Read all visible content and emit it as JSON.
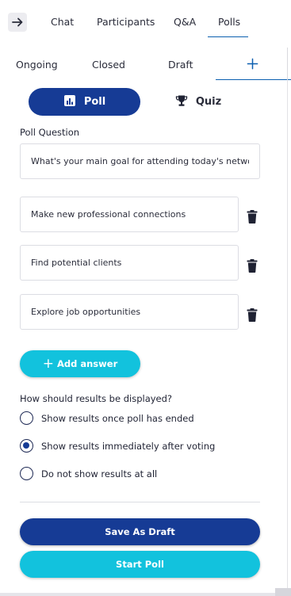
{
  "header": {
    "tabs": [
      "Chat",
      "Participants",
      "Q&A",
      "Polls"
    ],
    "active_tab": "Polls",
    "back_icon": "arrow-right-icon"
  },
  "subtabs": {
    "items": [
      "Ongoing",
      "Closed",
      "Draft"
    ],
    "add_icon": "plus-icon"
  },
  "toggle": {
    "poll_label": "Poll",
    "quiz_label": "Quiz",
    "selected": "Poll"
  },
  "question": {
    "label": "Poll Question",
    "value": "What's your main goal for attending today's networking event?"
  },
  "answers": [
    "Make new professional connections",
    "Find potential clients",
    "Explore job opportunities"
  ],
  "add_answer_label": "Add answer",
  "results": {
    "label": "How should results be displayed?",
    "options": [
      "Show results once poll has ended",
      "Show results immediately after voting",
      "Do not show results at all"
    ],
    "selected_index": 1
  },
  "actions": {
    "save_draft": "Save As Draft",
    "start": "Start Poll"
  },
  "colors": {
    "primary": "#163b95",
    "accent": "#12c2dd",
    "tab_underline": "#0b5fb0"
  }
}
